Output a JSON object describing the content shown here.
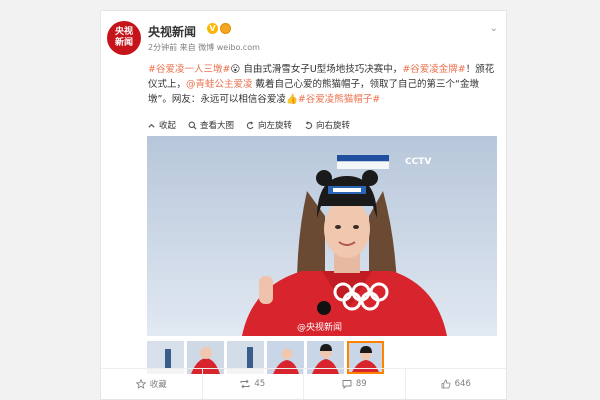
{
  "post": {
    "avatar_line1": "央视",
    "avatar_line2": "新闻",
    "username": "央视新闻",
    "time": "2分钟前",
    "source_label": "来自",
    "source": "微博 weibo.com",
    "text": {
      "hashtag1": "#谷爱凌一人三墩#",
      "emoji": "😮",
      "seg1": " 自由式滑雪女子U型场地技巧决赛中，",
      "hashtag2": "#谷爱凌金牌#",
      "seg2": "！颁花仪式上，",
      "mention": "@青蛙公主爱凌",
      "seg3": " 戴着自己心爱的熊猫帽子，领取了自己的第三个“金墩墩”。网友：永远可以相信谷爱凌",
      "emoji2": "👍",
      "hashtag3": "#谷爱凌熊猫帽子#"
    }
  },
  "toolbar": {
    "collapse": "收起",
    "view_large": "查看大图",
    "rotate_left": "向左旋转",
    "rotate_right": "向右旋转"
  },
  "photo": {
    "badge": "CCTV",
    "watermark": "@央视新闻"
  },
  "thumbnails": {
    "count": 6,
    "active_index": 5
  },
  "footer": {
    "favorite": "收藏",
    "repost": "45",
    "comment": "89",
    "like": "646"
  }
}
